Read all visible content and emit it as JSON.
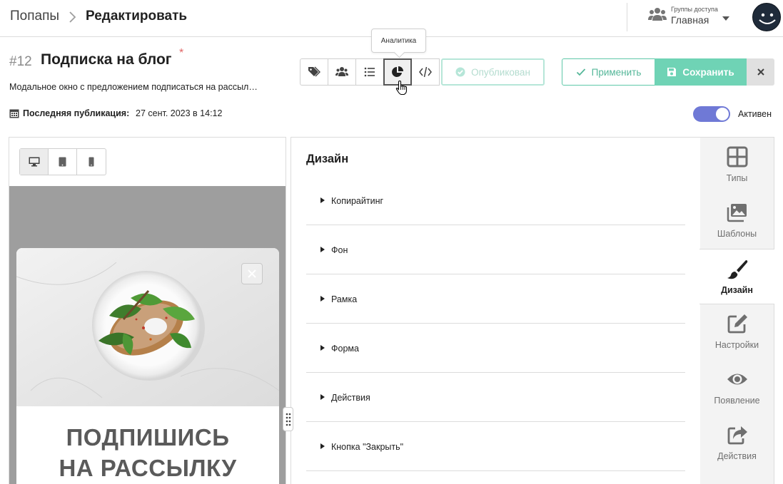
{
  "breadcrumb": {
    "root": "Попапы",
    "current": "Редактировать"
  },
  "access": {
    "caption": "Группы доступа",
    "value": "Главная"
  },
  "item": {
    "number": "#12",
    "title": "Подписка на блог",
    "required_mark": "*",
    "description": "Модальное окно с предложением подписаться на рассыл…",
    "last_published_label": "Последняя публикация:",
    "last_published_value": "27 сент. 2023 в 14:12"
  },
  "toolbar": {
    "tooltip": "Аналитика",
    "buttons": [
      "tags-icon",
      "users-icon",
      "list-icon",
      "chart-pie-icon",
      "code-icon"
    ],
    "published_label": "Опубликован",
    "apply_label": "Применить",
    "save_label": "Сохранить"
  },
  "status": {
    "label": "Активен",
    "enabled": true
  },
  "preview": {
    "devices": [
      "desktop-icon",
      "tablet-icon",
      "mobile-icon"
    ],
    "active_device": "desktop",
    "popup_heading_line1": "ПОДПИШИСЬ",
    "popup_heading_line2": "НА РАССЫЛКУ"
  },
  "design": {
    "title": "Дизайн",
    "sections": [
      "Копирайтинг",
      "Фон",
      "Рамка",
      "Форма",
      "Действия",
      "Кнопка \"Закрыть\""
    ]
  },
  "sidenav": {
    "items": [
      {
        "label": "Типы",
        "icon": "grid-icon"
      },
      {
        "label": "Шаблоны",
        "icon": "images-icon"
      },
      {
        "label": "Дизайн",
        "icon": "brush-icon"
      },
      {
        "label": "Настройки",
        "icon": "edit-icon"
      },
      {
        "label": "Появление",
        "icon": "eye-icon"
      },
      {
        "label": "Действия",
        "icon": "share-icon"
      }
    ],
    "active": "Дизайн"
  },
  "colors": {
    "accent_green": "#6fd3b5",
    "toggle_blue": "#6f79d6",
    "required_red": "#e06666"
  }
}
